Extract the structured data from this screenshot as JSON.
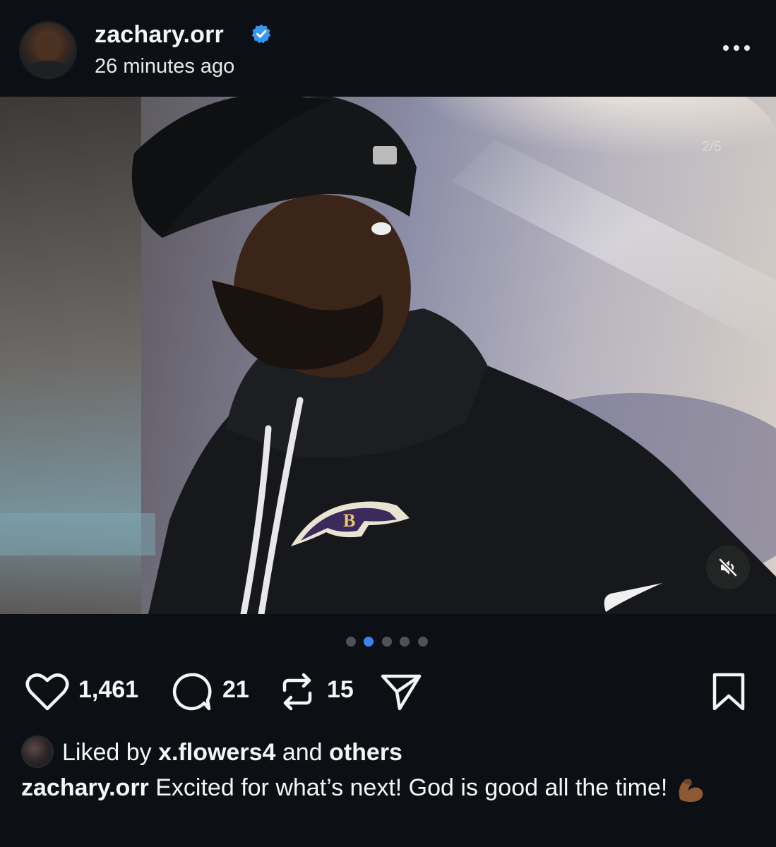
{
  "post": {
    "username": "zachary.orr",
    "verified": true,
    "timestamp": "26 minutes ago",
    "more_icon": "more-horizontal-icon"
  },
  "media": {
    "image_counter": "2/5",
    "mute_icon": "muted-speaker-icon",
    "carousel": {
      "total": 5,
      "active_index": 1
    }
  },
  "actions": {
    "likes_count": "1,461",
    "comments_count": "21",
    "reposts_count": "15",
    "icons": [
      "heart-icon",
      "comment-icon",
      "repost-icon",
      "share-icon",
      "bookmark-icon"
    ]
  },
  "liked_by": {
    "prefix": "Liked by",
    "user": "x.flowers4",
    "conjunction": "and",
    "suffix": "others"
  },
  "caption": {
    "username": "zachary.orr",
    "text": "Excited for what’s next! God is good all the time!",
    "emoji": "flexed-biceps"
  },
  "colors": {
    "background": "#0c1014",
    "verified_blue": "#3897f0",
    "active_dot": "#3b82f6"
  }
}
